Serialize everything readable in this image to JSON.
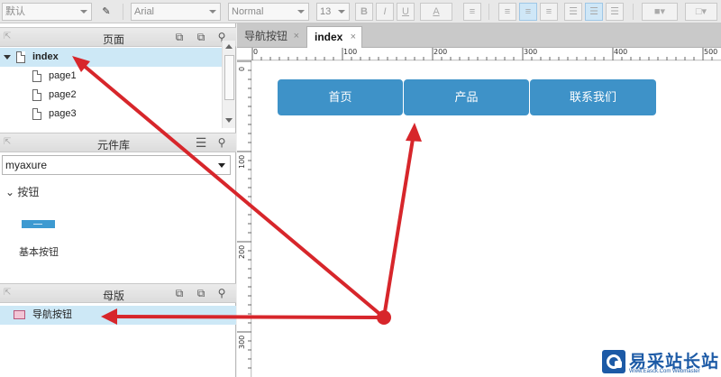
{
  "toolbar": {
    "style_select": "默认",
    "font_select": "Arial",
    "weight_select": "Normal",
    "size_select": "13",
    "bold": "B",
    "italic": "I",
    "underline": "U",
    "font_color": "A"
  },
  "pages_panel": {
    "title": "页面",
    "items": [
      {
        "label": "index"
      },
      {
        "label": "page1"
      },
      {
        "label": "page2"
      },
      {
        "label": "page3"
      }
    ]
  },
  "library_panel": {
    "title": "元件库",
    "selected_library": "myaxure",
    "group_label": "按钮",
    "widget_label": "基本按钮"
  },
  "masters_panel": {
    "title": "母版",
    "items": [
      {
        "label": "导航按钮"
      }
    ]
  },
  "tabs": [
    {
      "label": "导航按钮",
      "close": "×"
    },
    {
      "label": "index",
      "close": "×"
    }
  ],
  "ruler": {
    "top": [
      "0",
      "100",
      "200",
      "300",
      "400",
      "500"
    ],
    "left": [
      "0",
      "100",
      "200",
      "300"
    ]
  },
  "canvas": {
    "nav_buttons": [
      {
        "label": "首页"
      },
      {
        "label": "产品"
      },
      {
        "label": "联系我们"
      }
    ]
  },
  "watermark": {
    "brand": "易采站长站",
    "sub": "Www.Easck.Com Webmaster"
  },
  "colors": {
    "nav_button": "#3e92c8",
    "selection": "#cde8f6",
    "annotation_arrow": "#d7262b"
  }
}
